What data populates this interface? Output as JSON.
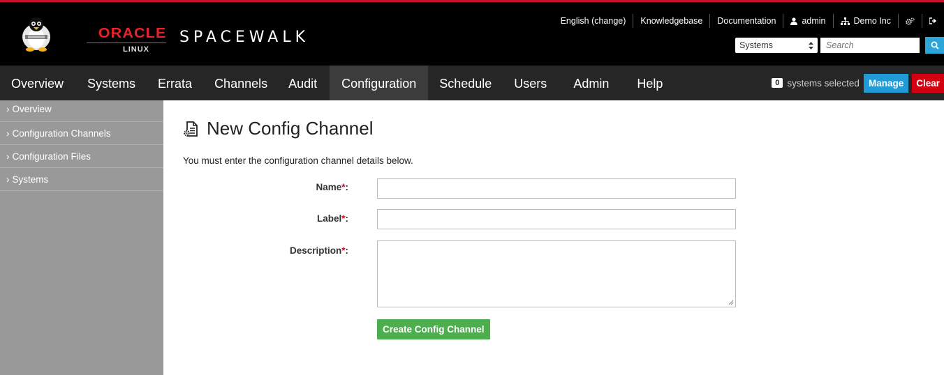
{
  "colors": {
    "accent_red": "#c8102e",
    "manage_blue": "#1f9bd7",
    "clear_red": "#d40010",
    "create_green": "#4cae4c",
    "sidebar_gray": "#999999",
    "nav_bg": "#262626"
  },
  "brand": {
    "oracle": "ORACLE",
    "linux": "LINUX",
    "product": "SPACEWALK",
    "mascot_icon": "tux-penguin-icon"
  },
  "utility": {
    "language": "English (change)",
    "knowledgebase": "Knowledgebase",
    "documentation": "Documentation",
    "user": "admin",
    "org": "Demo Inc",
    "user_icon": "user-icon",
    "org_icon": "organization-icon",
    "settings_icon": "gears-icon",
    "logout_icon": "sign-out-icon"
  },
  "search": {
    "scope": "Systems",
    "placeholder": "Search",
    "button_icon": "search-icon"
  },
  "nav": {
    "items": [
      {
        "label": "Overview"
      },
      {
        "label": "Systems"
      },
      {
        "label": "Errata"
      },
      {
        "label": "Channels"
      },
      {
        "label": "Audit"
      },
      {
        "label": "Configuration",
        "active": true
      },
      {
        "label": "Schedule"
      },
      {
        "label": "Users"
      },
      {
        "label": "Admin"
      },
      {
        "label": "Help"
      }
    ],
    "systems_selected_count": "0",
    "systems_selected_text": "systems selected",
    "manage": "Manage",
    "clear": "Clear"
  },
  "sidebar": {
    "items": [
      {
        "label": "Overview"
      },
      {
        "label": "Configuration Channels"
      },
      {
        "label": "Configuration Files"
      },
      {
        "label": "Systems"
      }
    ]
  },
  "main": {
    "title": "New Config Channel",
    "title_icon": "config-file-icon",
    "intro": "You must enter the configuration channel details below.",
    "fields": {
      "name_label": "Name",
      "name_value": "",
      "label_label": "Label",
      "label_value": "",
      "description_label": "Description",
      "description_value": ""
    },
    "required_mark": "*",
    "colon": ":",
    "submit": "Create Config Channel"
  }
}
